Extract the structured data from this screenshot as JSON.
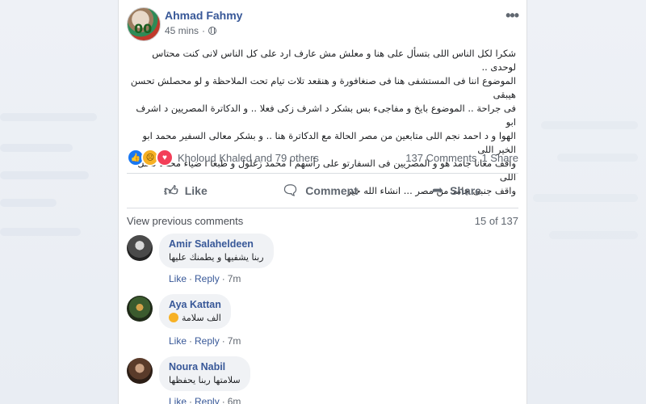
{
  "post": {
    "author": "Ahmad Fahmy",
    "time": "45 mins",
    "separator": "·",
    "avatar_number": "00",
    "text": "شكرا لكل الناس اللى بتسأل على هنا و معلش مش عارف ارد على كل الناس لانى كنت محتاس لوحدى ..\nالموضوع اننا فى المستشفى هنا فى صنغافورة و هنقعد تلات تيام تحت الملاحظة و لو محصلش تحسن هيبقى\nفى جراحة .. الموضوع بايخ و مفاجىء بس بشكر د اشرف زكى فعلا .. و الدكاترة المصريين د اشرف ابو\nالهوا و د احمد نجم اللى متابعين من مصر الحالة مع الدكاترة هنا .. و بشكر معالى السفير محمد ابو الخير اللى\nواقف معانا جامد هو و المصريين فى السفارتو على رأسهم ا محمد زغلول و طبعا ا ضياء محمد كامل اللى\nواقف جنبى جامد من مصر ... انشاء الله خير",
    "reactions_summary": "Kholoud Khaled and 79 others",
    "comments_count": "137 Comments",
    "shares_count": "1 Share",
    "reaction_icons": [
      "like-icon",
      "sad-icon",
      "love-icon"
    ]
  },
  "actions": {
    "like": "Like",
    "comment": "Comment",
    "share": "Share"
  },
  "comments_section": {
    "view_previous": "View previous comments",
    "count_label": "15 of 137",
    "like_label": "Like",
    "reply_label": "Reply",
    "dot": "·",
    "items": [
      {
        "name": "Amir Salaheldeen",
        "text": "ربنا يشفيها و يطمنك عليها",
        "time": "7m"
      },
      {
        "name": "Aya Kattan",
        "text": "الف سلامة",
        "time": "7m"
      },
      {
        "name": "Noura Nabil",
        "text": "سلامتها ربنا يحفظها",
        "time": "6m"
      }
    ]
  },
  "colors": {
    "link_blue": "#385898",
    "like_blue": "#1877f2",
    "secondary_text": "#606770"
  }
}
